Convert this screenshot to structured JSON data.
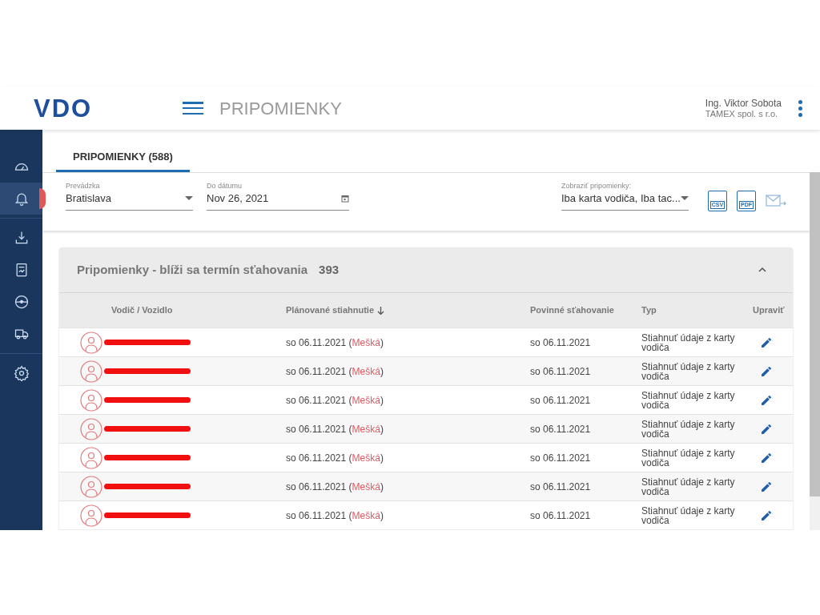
{
  "header": {
    "logo": "VDO",
    "title": "PRIPOMIENKY",
    "user_name": "Ing. Viktor Sobota",
    "company": "TAMEX spol. s r.o."
  },
  "sidebar": {
    "items": [
      {
        "kind": "gauge",
        "selected": false
      },
      {
        "kind": "bell",
        "selected": true
      },
      {
        "kind": "divider"
      },
      {
        "kind": "download",
        "selected": false
      },
      {
        "kind": "report",
        "selected": false
      },
      {
        "kind": "wheel",
        "selected": false
      },
      {
        "kind": "truck",
        "selected": false
      },
      {
        "kind": "divider"
      },
      {
        "kind": "gear",
        "selected": false
      }
    ]
  },
  "tabs": [
    {
      "label": "PRIPOMIENKY (588)",
      "selected": true
    }
  ],
  "filters": {
    "depot": {
      "label": "Prevádzka",
      "value": "Bratislava"
    },
    "date": {
      "label": "Do dátumu",
      "value": "Nov 26, 2021"
    },
    "show": {
      "label": "Zobraziť pripomienky:",
      "value": "Iba karta vodiča, Iba tac..."
    },
    "exports": [
      {
        "kind": "csv",
        "label": "CSV"
      },
      {
        "kind": "pdf",
        "label": "PDF"
      },
      {
        "kind": "mail"
      }
    ]
  },
  "panel": {
    "title": "Pripomienky - blíži sa termín sťahovania",
    "count": "393",
    "expanded": true,
    "columns": [
      "Vodič / Vozidlo",
      "Plánované stiahnutie",
      "Povinné sťahovanie",
      "Typ",
      "Upraviť"
    ],
    "rows": [
      {
        "planned": "so 06.11.2021",
        "status": "(Mešká)",
        "required": "so 06.11.2021",
        "type": "Stiahnuť údaje z karty vodiča"
      },
      {
        "planned": "so 06.11.2021",
        "status": "(Mešká)",
        "required": "so 06.11.2021",
        "type": "Stiahnuť údaje z karty vodiča"
      },
      {
        "planned": "so 06.11.2021",
        "status": "(Mešká)",
        "required": "so 06.11.2021",
        "type": "Stiahnuť údaje z karty vodiča"
      },
      {
        "planned": "so 06.11.2021",
        "status": "(Mešká)",
        "required": "so 06.11.2021",
        "type": "Stiahnuť údaje z karty vodiča"
      },
      {
        "planned": "so 06.11.2021",
        "status": "(Mešká)",
        "required": "so 06.11.2021",
        "type": "Stiahnuť údaje z karty vodiča"
      },
      {
        "planned": "so 06.11.2021",
        "status": "(Mešká)",
        "required": "so 06.11.2021",
        "type": "Stiahnuť údaje z karty vodiča"
      },
      {
        "planned": "so 06.11.2021",
        "status": "(Mešká)",
        "required": "so 06.11.2021",
        "type": "Stiahnuť údaje z karty vodiča"
      }
    ]
  }
}
